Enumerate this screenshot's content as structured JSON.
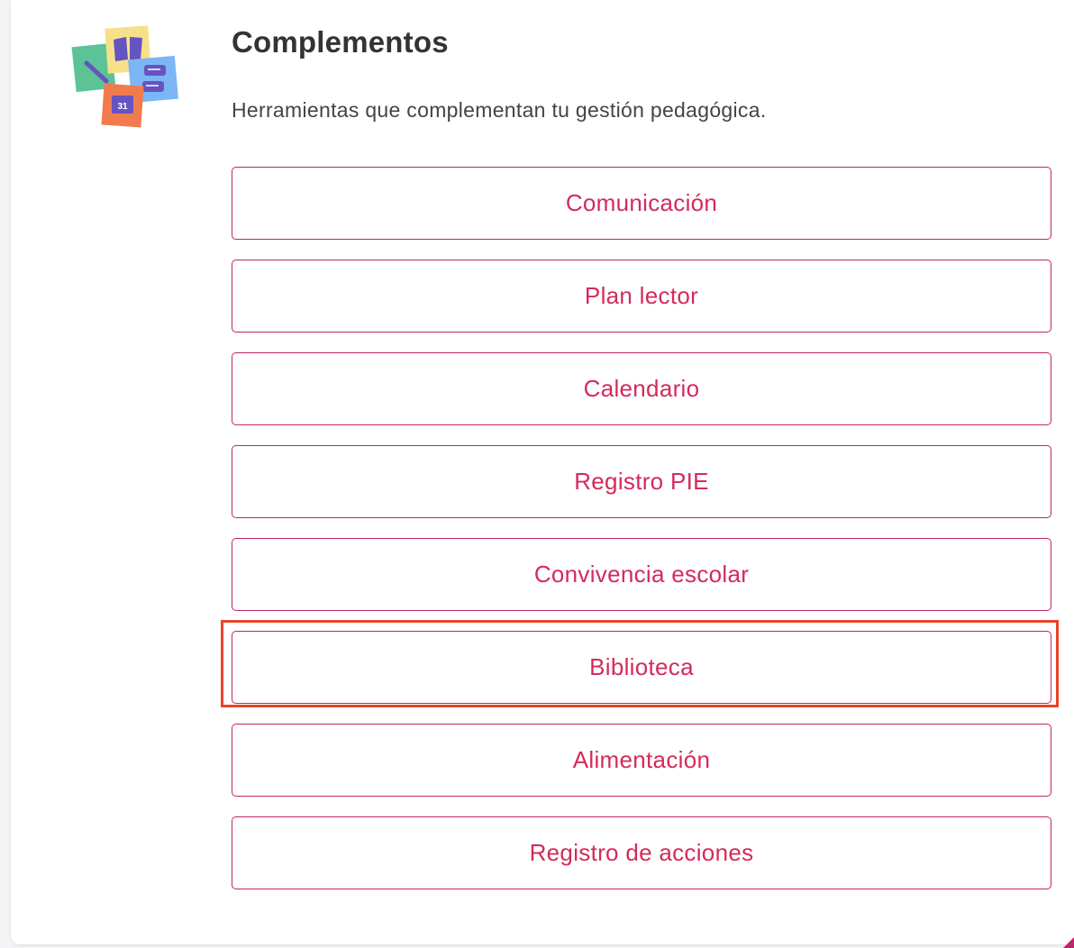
{
  "header": {
    "title": "Complementos",
    "subtitle": "Herramientas que complementan tu gestión pedagógica."
  },
  "illustration": {
    "icons": [
      "book-icon",
      "pencil-icon",
      "chat-icon",
      "calendar-icon"
    ],
    "calendar_day": "31",
    "colors": {
      "yellow": "#f7e08a",
      "green": "#5cc397",
      "blue": "#7cb6f5",
      "orange": "#f07c4e",
      "purple": "#6554c0"
    }
  },
  "tools": [
    {
      "label": "Comunicación"
    },
    {
      "label": "Plan lector"
    },
    {
      "label": "Calendario"
    },
    {
      "label": "Registro PIE"
    },
    {
      "label": "Convivencia escolar"
    },
    {
      "label": "Biblioteca",
      "highlighted": true
    },
    {
      "label": "Alimentación"
    },
    {
      "label": "Registro de acciones"
    }
  ],
  "colors": {
    "accent_text": "#d42a5c",
    "button_border": "#c0246a",
    "highlight_border": "#e8432a"
  }
}
